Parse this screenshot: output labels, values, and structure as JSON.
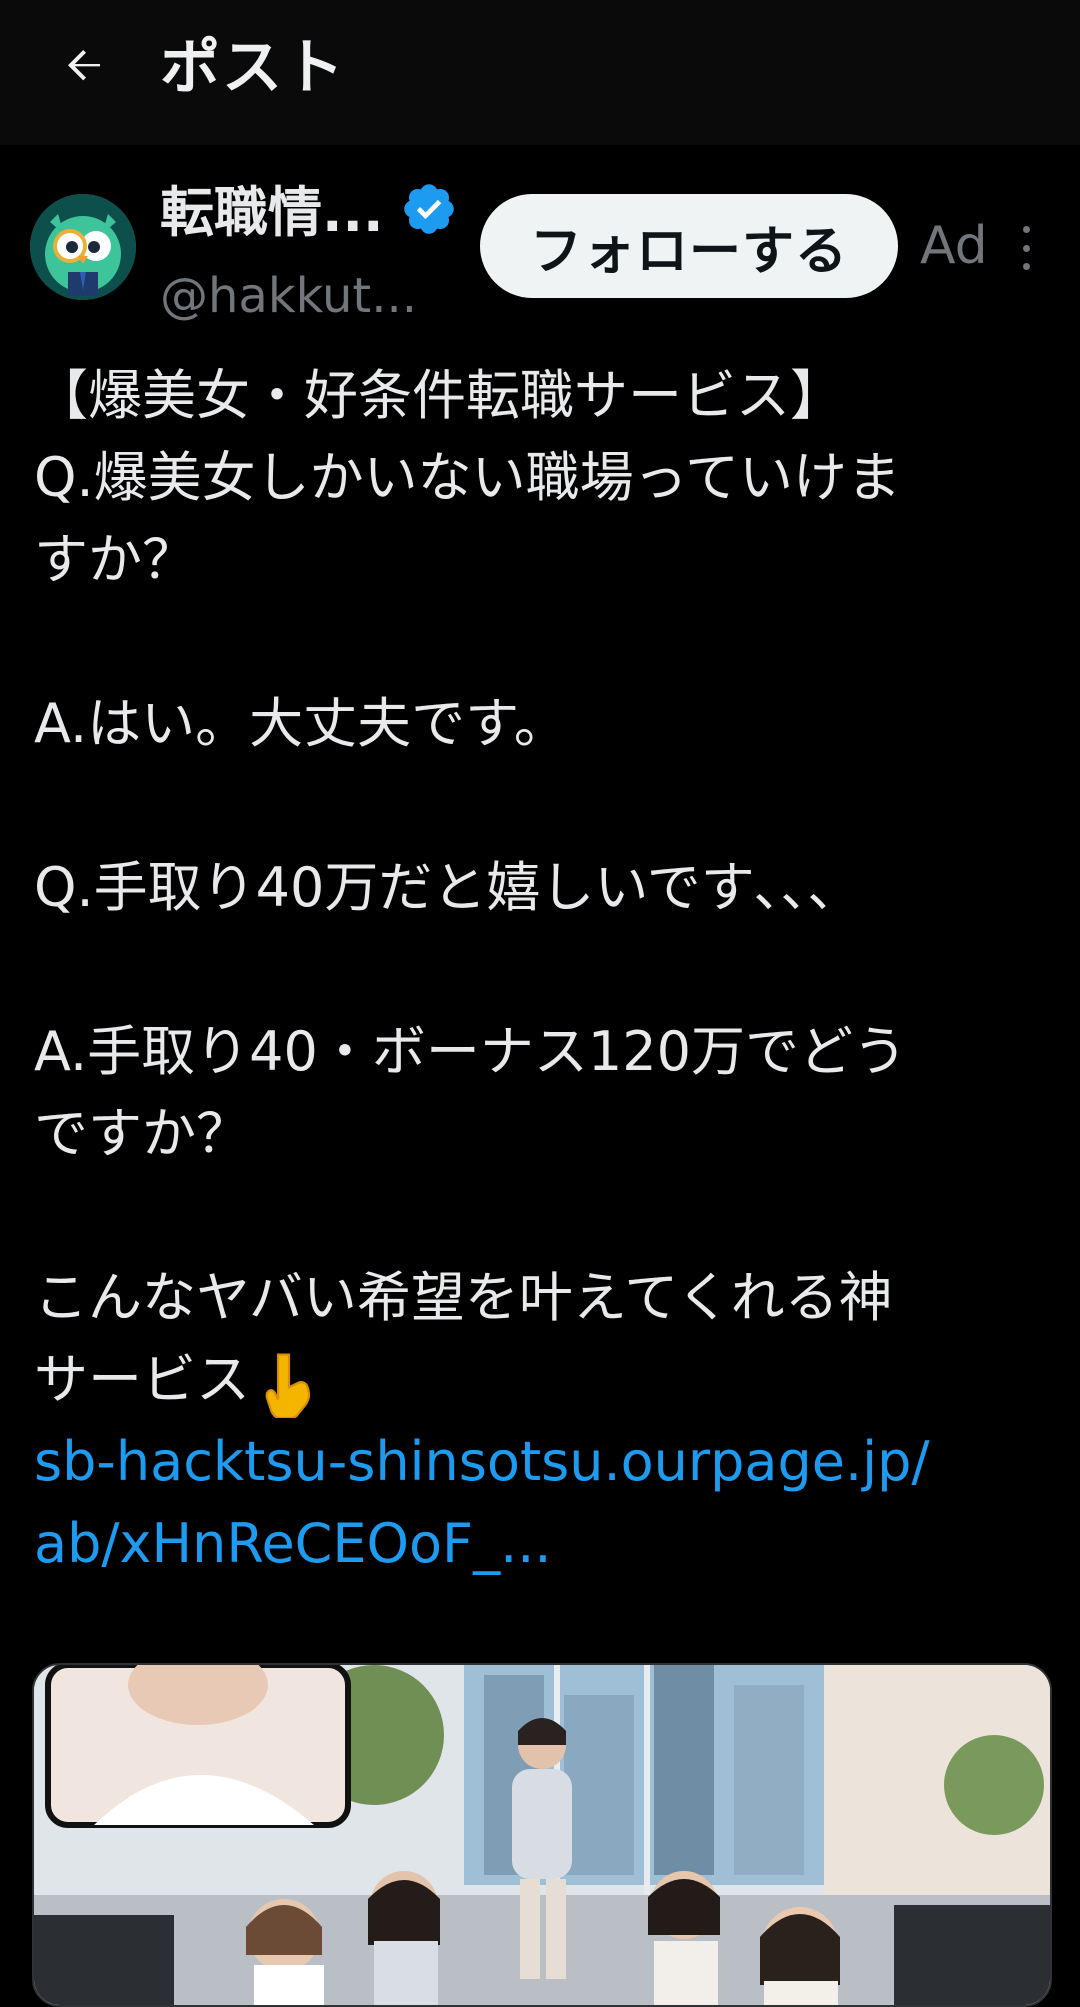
{
  "header": {
    "title": "ポスト",
    "back_icon": "arrow-left-icon"
  },
  "author": {
    "name": "転職情...",
    "handle": "@hakkut...",
    "verified_icon": "verified-badge-icon",
    "verified_color": "#1d9bf0",
    "follow_label": "フォローする",
    "ad_label": "Ad",
    "more_icon": "more-vertical-icon"
  },
  "post": {
    "lines": [
      "【爆美女・好条件転職サービス】",
      "Q.爆美女しかいない職場っていけま",
      "すか？",
      "",
      "A.はい。大丈夫です。",
      "",
      "Q.手取り40万だと嬉しいです､､､",
      "",
      "A.手取り40・ボーナス120万でどう",
      "ですか？",
      "",
      "こんなヤバい希望を叶えてくれる神",
      "サービス"
    ],
    "pointer_emoji": "pointing-down-emoji",
    "link_lines": [
      "sb-hacktsu-shinsotsu.ourpage.jp/",
      "ab/xHnReCEOoF_..."
    ]
  },
  "media": {
    "description_icon": "office-photo-image"
  },
  "colors": {
    "background": "#000000",
    "text": "#e7e9ea",
    "muted": "#71767b",
    "link": "#1d9bf0",
    "follow_bg": "#eff3f4"
  }
}
